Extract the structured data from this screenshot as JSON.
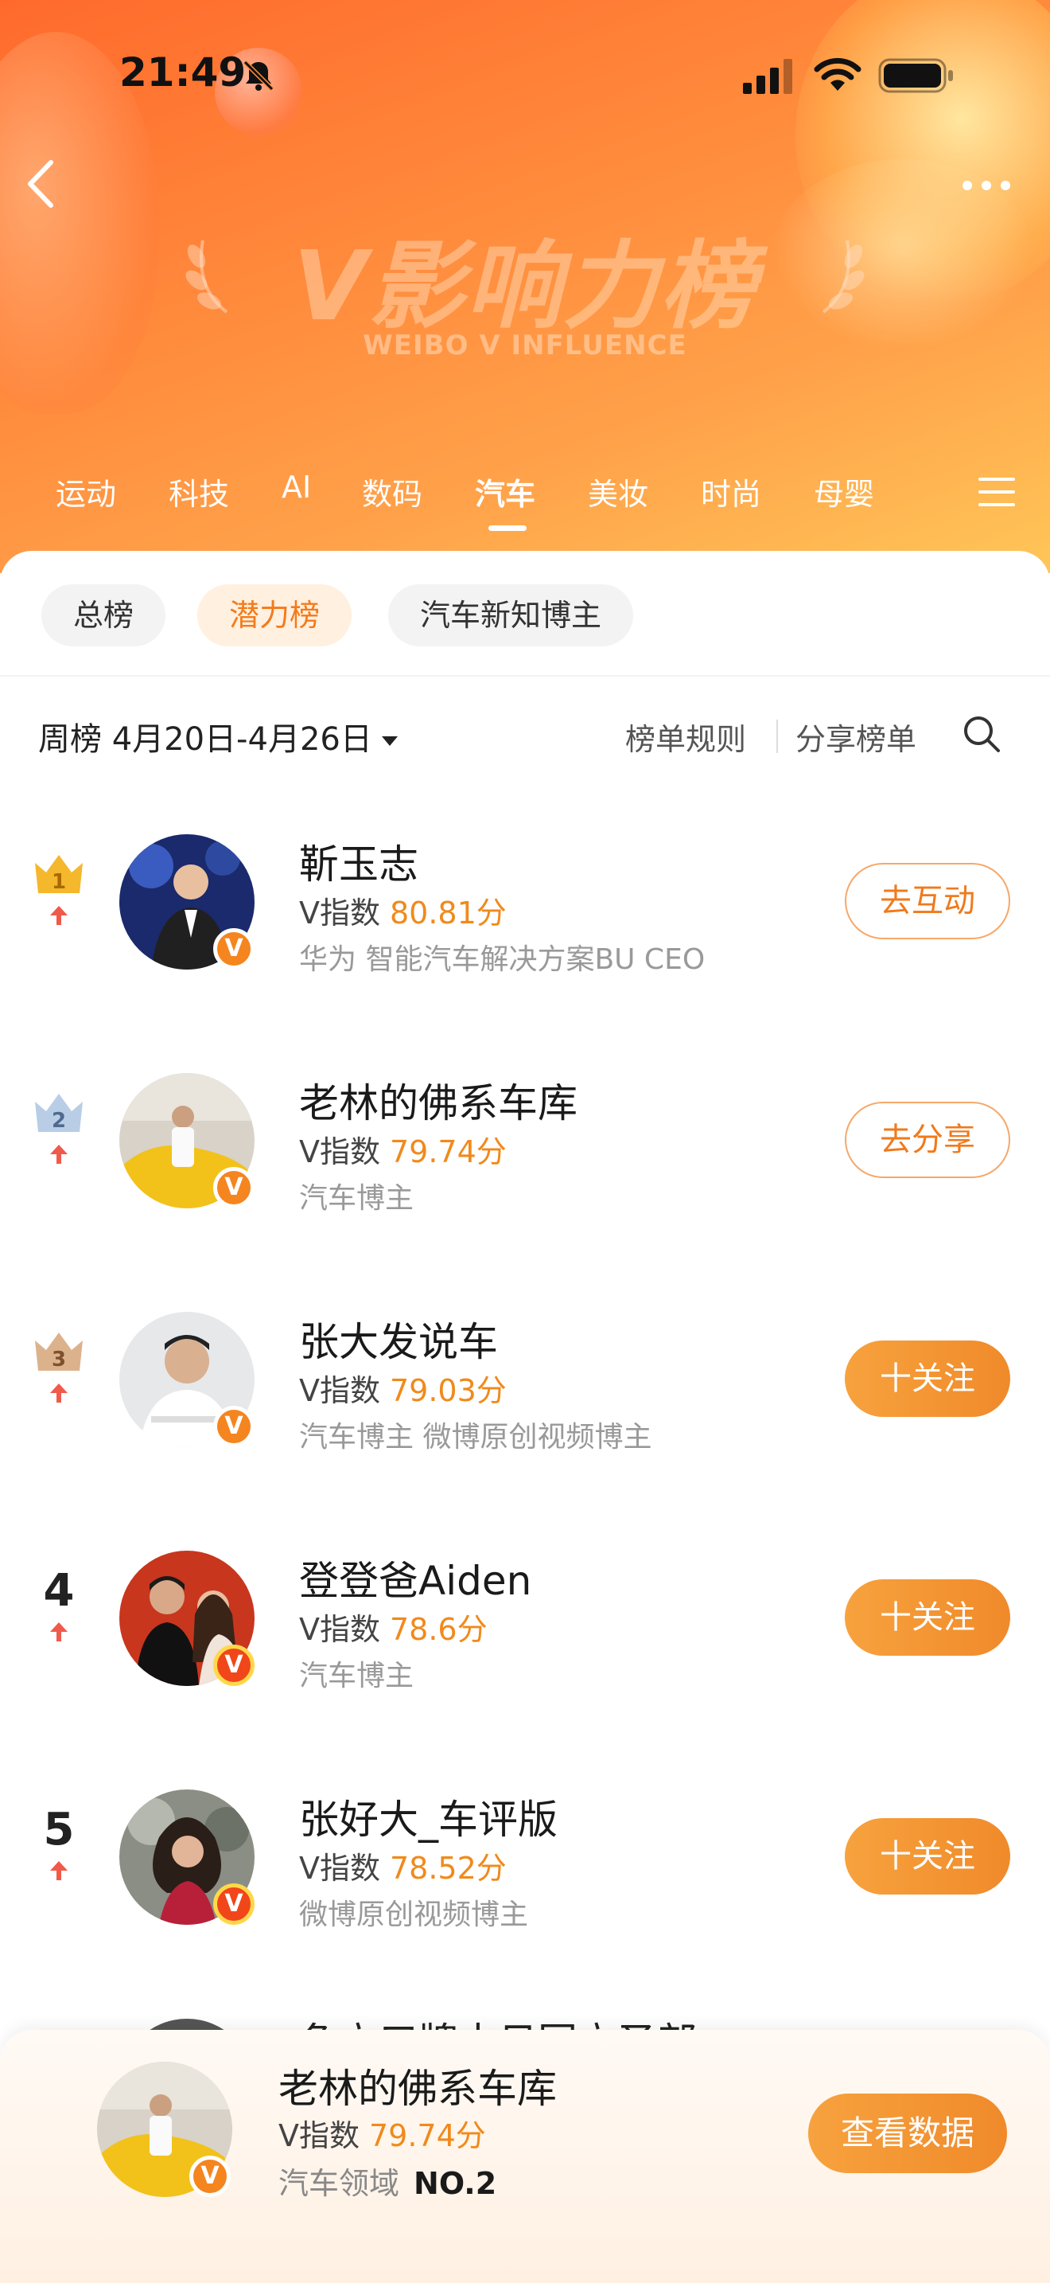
{
  "status_bar": {
    "time": "21:49"
  },
  "hero": {
    "title": "V影响力榜",
    "subtitle": "WEIBO V INFLUENCE"
  },
  "category_tabs": [
    {
      "label": "运动"
    },
    {
      "label": "科技"
    },
    {
      "label": "AI"
    },
    {
      "label": "数码"
    },
    {
      "label": "汽车",
      "active": true
    },
    {
      "label": "美妆"
    },
    {
      "label": "时尚"
    },
    {
      "label": "母婴"
    }
  ],
  "sub_tabs": [
    {
      "label": "总榜"
    },
    {
      "label": "潜力榜",
      "active": true
    },
    {
      "label": "汽车新知博主"
    }
  ],
  "toolbar": {
    "period": "周榜 4月20日-4月26日",
    "rules": "榜单规则",
    "share": "分享榜单"
  },
  "rankings": [
    {
      "rank": "1",
      "name": "靳玉志",
      "v_label": "V指数",
      "score": "80.81分",
      "desc": "华为 智能汽车解决方案BU CEO",
      "action": "去互动",
      "action_style": "outline",
      "trend": "up"
    },
    {
      "rank": "2",
      "name": "老林的佛系车库",
      "v_label": "V指数",
      "score": "79.74分",
      "desc": "汽车博主",
      "action": "去分享",
      "action_style": "outline",
      "trend": "up"
    },
    {
      "rank": "3",
      "name": "张大发说车",
      "v_label": "V指数",
      "score": "79.03分",
      "desc": "汽车博主 微博原创视频博主",
      "action": "十关注",
      "action_style": "solid",
      "trend": "up"
    },
    {
      "rank": "4",
      "name": "登登爸Aiden",
      "v_label": "V指数",
      "score": "78.6分",
      "desc": "汽车博主",
      "action": "十关注",
      "action_style": "solid",
      "trend": "up"
    },
    {
      "rank": "5",
      "name": "张好大_车评版",
      "v_label": "V指数",
      "score": "78.52分",
      "desc": "微博原创视频博主",
      "action": "十关注",
      "action_style": "solid",
      "trend": "up"
    }
  ],
  "partial_next_row": {
    "name": "鱼立口牌士日国立圣部"
  },
  "my_card": {
    "name": "老林的佛系车库",
    "v_label": "V指数",
    "score": "79.74分",
    "domain": "汽车领域",
    "rank": "NO.2",
    "button": "查看数据"
  },
  "colors": {
    "accent": "#f08a1c",
    "header_orange": "#ff7a32",
    "active_subtab_bg": "#fff0e0"
  }
}
